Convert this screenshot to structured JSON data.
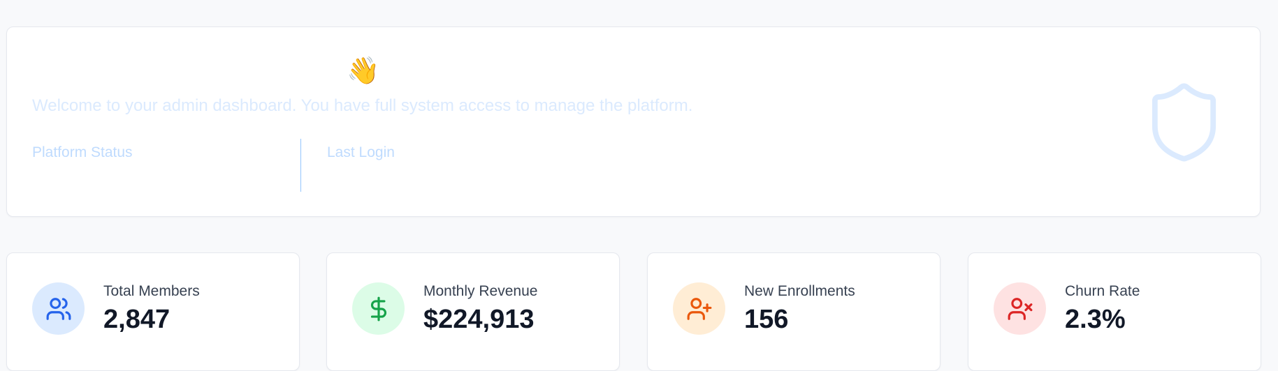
{
  "welcome": {
    "emoji": "👋",
    "subtitle": "Welcome to your admin dashboard. You have full system access to manage the platform.",
    "platform_status_label": "Platform Status",
    "last_login_label": "Last Login",
    "decor_icon": "shield-icon"
  },
  "stats": [
    {
      "label": "Total Members",
      "value": "2,847",
      "icon": "users-icon",
      "icon_color": "#2563eb",
      "icon_bg": "#dbeafe"
    },
    {
      "label": "Monthly Revenue",
      "value": "$224,913",
      "icon": "dollar-sign-icon",
      "icon_color": "#16a34a",
      "icon_bg": "#dcfce7"
    },
    {
      "label": "New Enrollments",
      "value": "156",
      "icon": "user-plus-icon",
      "icon_color": "#ea580c",
      "icon_bg": "#ffedd5"
    },
    {
      "label": "Churn Rate",
      "value": "2.3%",
      "icon": "user-x-icon",
      "icon_color": "#dc2626",
      "icon_bg": "#fee2e2"
    }
  ],
  "colors": {
    "page_background": "#f8f9fb",
    "card_background": "#ffffff",
    "welcome_text": "#dbeafe",
    "welcome_label": "#bfdbfe",
    "divider": "#93c5fd",
    "shield": "#dbeafe"
  }
}
